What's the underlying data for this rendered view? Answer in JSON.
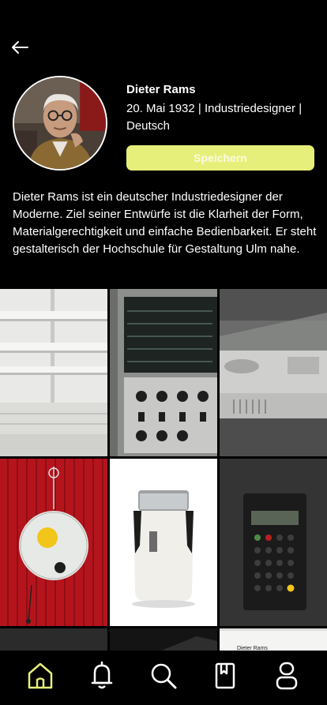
{
  "profile": {
    "name": "Dieter Rams",
    "meta": "20. Mai 1932 | Industriedesigner | Deutsch",
    "save_label": "Speichern",
    "bio": "Dieter Rams ist ein deutscher Industriedesigner der Moderne. Ziel seiner Entwürfe ist die Klarheit der Form, Materialgerechtigkeit und einfache Bedienbarkeit. Er steht gestalterisch der Hochschule für Gestaltung Ulm nahe."
  },
  "gallery": {
    "items": [
      {
        "icon": "shelving-system-image"
      },
      {
        "icon": "world-receiver-radio-image"
      },
      {
        "icon": "record-player-image"
      },
      {
        "icon": "wall-clock-image"
      },
      {
        "icon": "electric-shaver-image"
      },
      {
        "icon": "calculator-image"
      },
      {
        "icon": "dark-product-image"
      },
      {
        "icon": "dark-product-image"
      },
      {
        "icon": "book-cover-image",
        "caption": "Dieter Rams"
      }
    ]
  },
  "nav": {
    "items": [
      {
        "icon": "home-icon",
        "active": true
      },
      {
        "icon": "bell-icon",
        "active": false
      },
      {
        "icon": "search-icon",
        "active": false
      },
      {
        "icon": "bookmark-icon",
        "active": false
      },
      {
        "icon": "profile-icon",
        "active": false
      }
    ]
  },
  "colors": {
    "background": "#000000",
    "accent": "#e6ef7a",
    "text": "#ffffff"
  }
}
